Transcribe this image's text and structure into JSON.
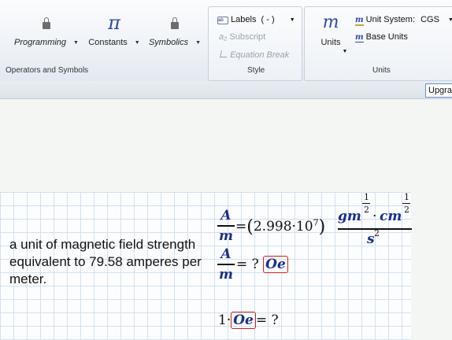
{
  "ribbon": {
    "buttons": {
      "programming": "Programming",
      "constants": "Constants",
      "constants_symbol": "π",
      "symbolics": "Symbolics",
      "units": "Units",
      "units_symbol": "m"
    },
    "style": {
      "labels": "Labels",
      "labels_value": "( - )",
      "subscript": "Subscript",
      "subscript_prefix": "a₂",
      "equation_break": "Equation Break"
    },
    "units_group": {
      "unit_system_label": "Unit System:",
      "unit_system_value": "CGS",
      "base_units": "Base Units"
    },
    "group_labels": {
      "operators": "Operators and Symbols",
      "style": "Style",
      "units": "Units"
    },
    "upgrade": "Upgra"
  },
  "worksheet": {
    "description": "a unit of magnetic field strength equivalent to 79.58 amperes per meter.",
    "eq1": {
      "numerator": "A",
      "denominator": "m",
      "equals": "=",
      "coefficient": "2.998",
      "base": "10",
      "exponent": "7",
      "unit_gm": "gm",
      "half": "1",
      "two": "2",
      "unit_cm": "cm",
      "unit_s": "s",
      "s_exp": "2"
    },
    "eq2": {
      "numerator": "A",
      "denominator": "m",
      "result": "= ?",
      "unit": "Oe"
    },
    "eq3": {
      "coefficient": "1",
      "unit": "Oe",
      "result": "= ?"
    }
  }
}
